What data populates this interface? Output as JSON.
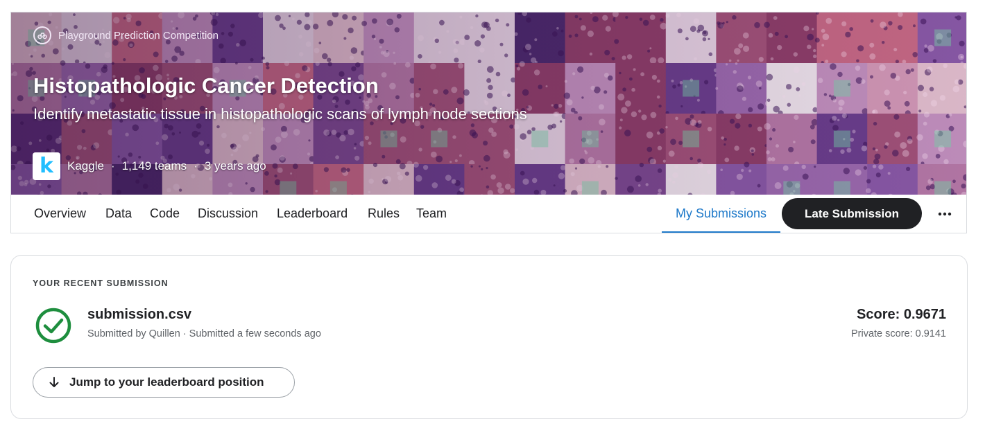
{
  "header": {
    "badge_text": "Playground Prediction Competition",
    "title": "Histopathologic Cancer Detection",
    "subtitle": "Identify metastatic tissue in histopathologic scans of lymph node sections",
    "host_logo_letter": "k",
    "host_name": "Kaggle",
    "separator": "·",
    "teams": "1,149 teams",
    "age": "3 years ago",
    "icons": {
      "badge": "playground-icon"
    }
  },
  "tabs": {
    "items": [
      "Overview",
      "Data",
      "Code",
      "Discussion",
      "Leaderboard",
      "Rules",
      "Team"
    ],
    "my_submissions": "My Submissions",
    "late_submission": "Late Submission",
    "more": "more-options-icon",
    "active": "My Submissions"
  },
  "submission": {
    "heading": "YOUR RECENT SUBMISSION",
    "file_name": "submission.csv",
    "meta": "Submitted by Quillen · Submitted a few seconds ago",
    "score": "Score: 0.9671",
    "private_score": "Private score: 0.9141",
    "jump_label": "Jump to your leaderboard position",
    "status": "success",
    "status_icon": "check-circle-icon"
  },
  "colors": {
    "accent": "#1e79c9",
    "success": "#1e8e3e",
    "dark_button": "#202124",
    "kaggle_blue": "#20beff"
  }
}
